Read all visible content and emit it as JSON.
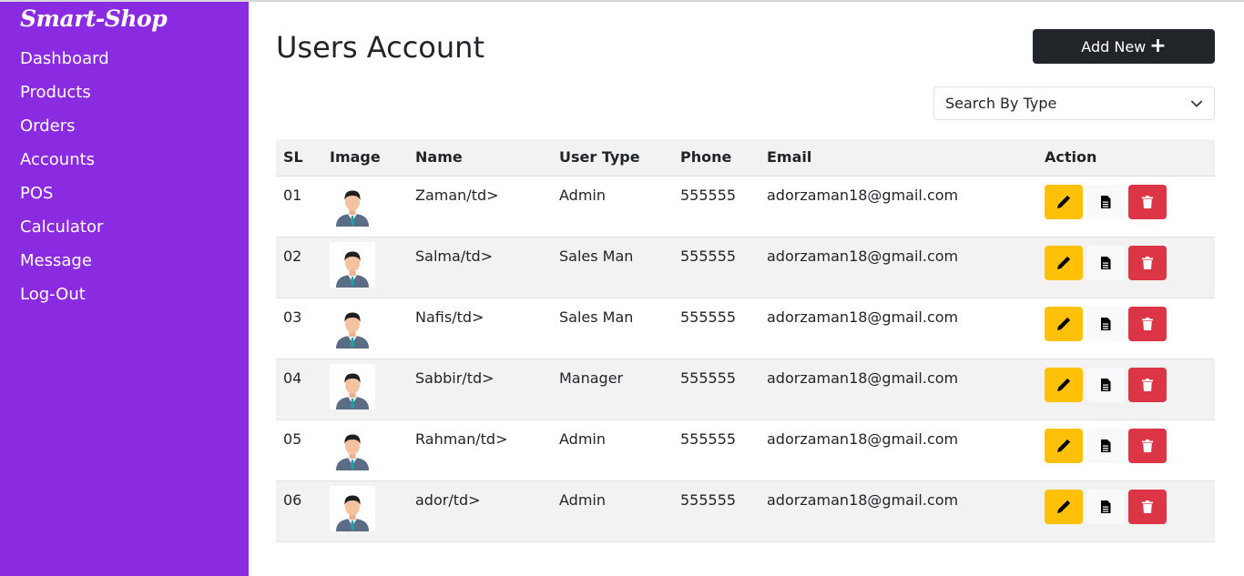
{
  "sidebar": {
    "brand": "Smart-Shop",
    "items": [
      {
        "label": "Dashboard"
      },
      {
        "label": "Products"
      },
      {
        "label": "Orders"
      },
      {
        "label": "Accounts"
      },
      {
        "label": "POS"
      },
      {
        "label": "Calculator"
      },
      {
        "label": "Message"
      },
      {
        "label": "Log-Out"
      }
    ]
  },
  "main": {
    "title": "Users Account",
    "add_button_label": "Add New",
    "add_button_icon": "plus-icon",
    "search_select": {
      "selected": "Search By Type",
      "icon": "chevron-down-icon"
    }
  },
  "table": {
    "headers": {
      "sl": "SL",
      "image": "Image",
      "name": "Name",
      "user_type": "User Type",
      "phone": "Phone",
      "email": "Email",
      "action": "Action"
    },
    "rows": [
      {
        "sl": "01",
        "name": "Zaman/td>",
        "user_type": "Admin",
        "phone": "555555",
        "email": "adorzaman18@gmail.com"
      },
      {
        "sl": "02",
        "name": "Salma/td>",
        "user_type": "Sales Man",
        "phone": "555555",
        "email": "adorzaman18@gmail.com"
      },
      {
        "sl": "03",
        "name": "Nafis/td>",
        "user_type": "Sales Man",
        "phone": "555555",
        "email": "adorzaman18@gmail.com"
      },
      {
        "sl": "04",
        "name": "Sabbir/td>",
        "user_type": "Manager",
        "phone": "555555",
        "email": "adorzaman18@gmail.com"
      },
      {
        "sl": "05",
        "name": "Rahman/td>",
        "user_type": "Admin",
        "phone": "555555",
        "email": "adorzaman18@gmail.com"
      },
      {
        "sl": "06",
        "name": "ador/td>",
        "user_type": "Admin",
        "phone": "555555",
        "email": "adorzaman18@gmail.com"
      }
    ],
    "action_icons": [
      "pencil-icon",
      "document-icon",
      "trash-icon"
    ]
  },
  "colors": {
    "sidebar_bg": "#8a2be2",
    "add_button_bg": "#212529",
    "edit_button": "#ffc107",
    "view_button": "#f8f9fa",
    "delete_button": "#dc3545"
  }
}
